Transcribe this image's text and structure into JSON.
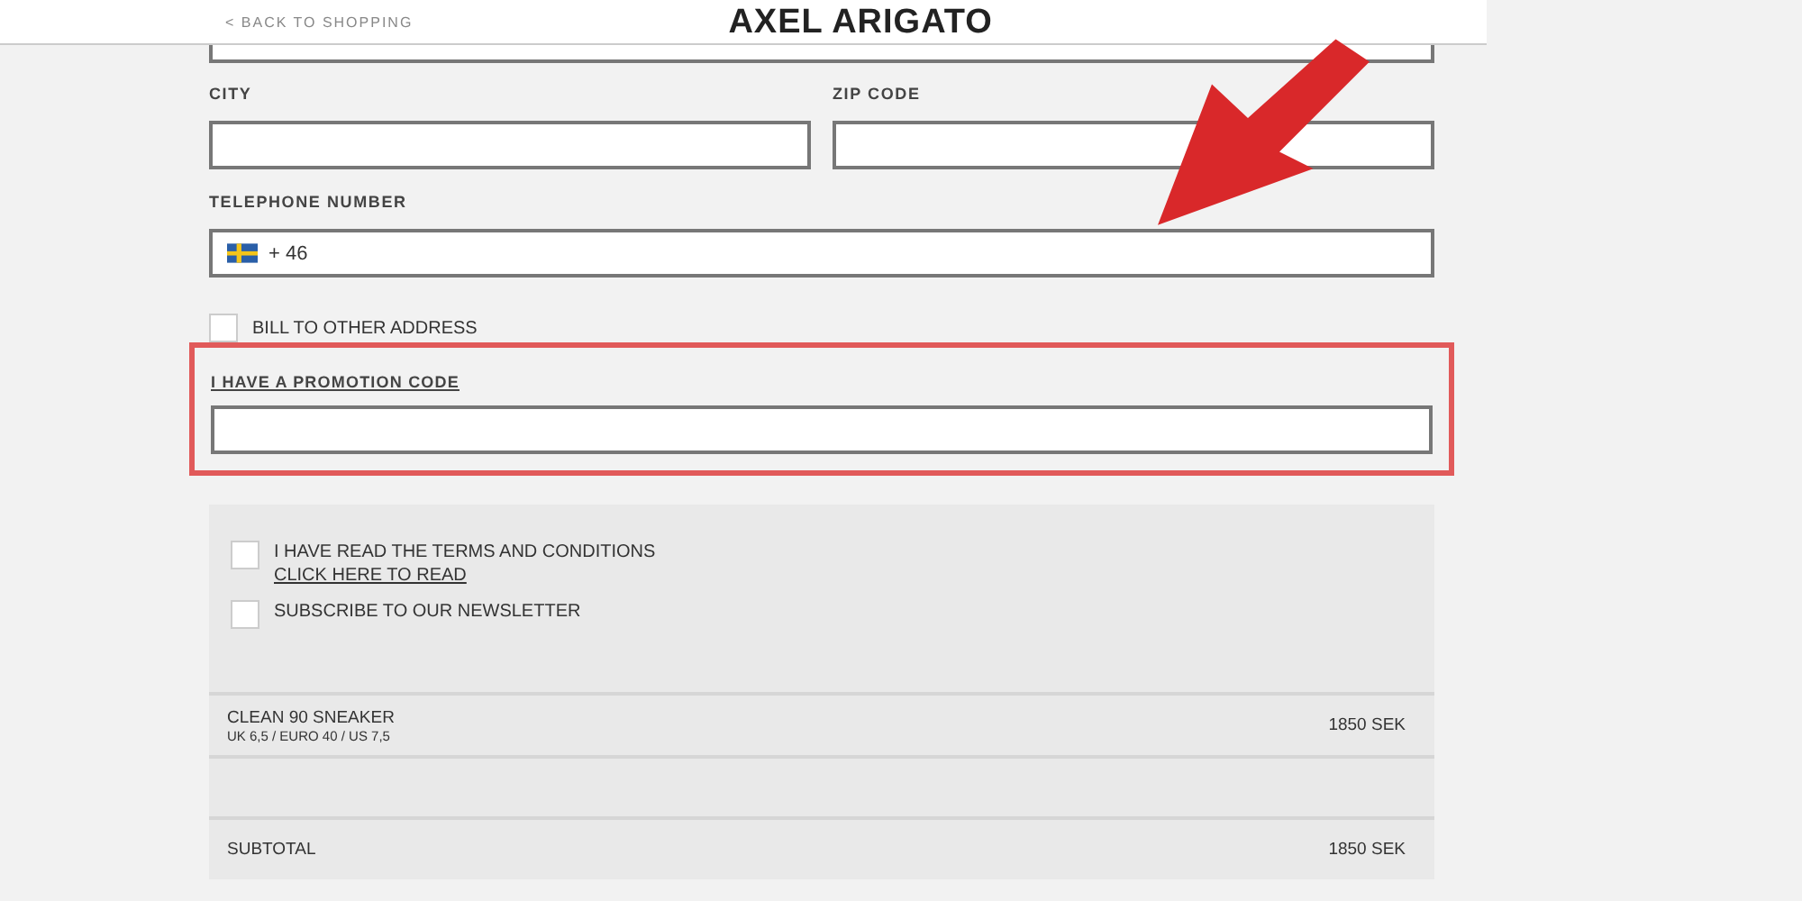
{
  "header": {
    "back_link": "< BACK TO SHOPPING",
    "logo": "AXEL ARIGATO"
  },
  "fields": [
    {
      "label": "CITY"
    },
    {
      "label": "ZIP CODE"
    }
  ],
  "telephone": {
    "label": "TELEPHONE NUMBER",
    "value": "+ 46"
  },
  "bill_to_other": {
    "label": "BILL TO OTHER ADDRESS",
    "checked": false
  },
  "promotion": {
    "link": "I HAVE A PROMOTION CODE",
    "highlighted": true
  },
  "agreements": [
    {
      "label": "I HAVE READ THE TERMS AND CONDITIONS",
      "link": "CLICK HERE TO READ",
      "checked": false
    },
    {
      "label": "SUBSCRIBE TO OUR NEWSLETTER",
      "checked": false
    }
  ],
  "cart": {
    "item": {
      "name": "CLEAN 90 SNEAKER",
      "size": "UK 6,5 / EURO 40 / US 7,5",
      "price": "1850 SEK"
    },
    "subtotal": {
      "label": "SUBTOTAL",
      "price": "1850 SEK"
    }
  }
}
